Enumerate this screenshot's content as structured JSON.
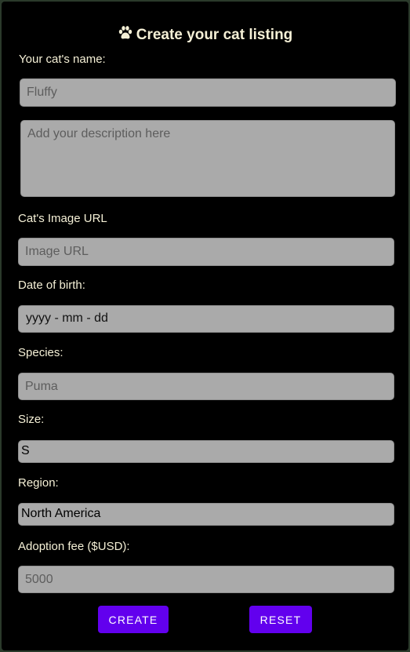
{
  "form": {
    "title": "Create your cat listing",
    "title_icon": "paw-icon",
    "name": {
      "label": "Your cat's name:",
      "placeholder": "Fluffy"
    },
    "description": {
      "placeholder": "Add your description here"
    },
    "image_url": {
      "label": "Cat's Image URL",
      "placeholder": "Image URL"
    },
    "date_of_birth": {
      "label": "Date of birth:",
      "format_text": "yyyy - mm - dd"
    },
    "species": {
      "label": "Species:",
      "placeholder": "Puma"
    },
    "size": {
      "label": "Size:",
      "selected": "S"
    },
    "region": {
      "label": "Region:",
      "selected": "North America"
    },
    "adoption_fee": {
      "label": "Adoption fee ($USD):",
      "placeholder": "5000"
    },
    "create_label": "CREATE",
    "reset_label": "RESET"
  },
  "colors": {
    "background": "#000000",
    "label_text": "#f5f0d6",
    "field_background": "#aaaaaa",
    "button": "#6200ee",
    "button_text": "#ffffff"
  }
}
